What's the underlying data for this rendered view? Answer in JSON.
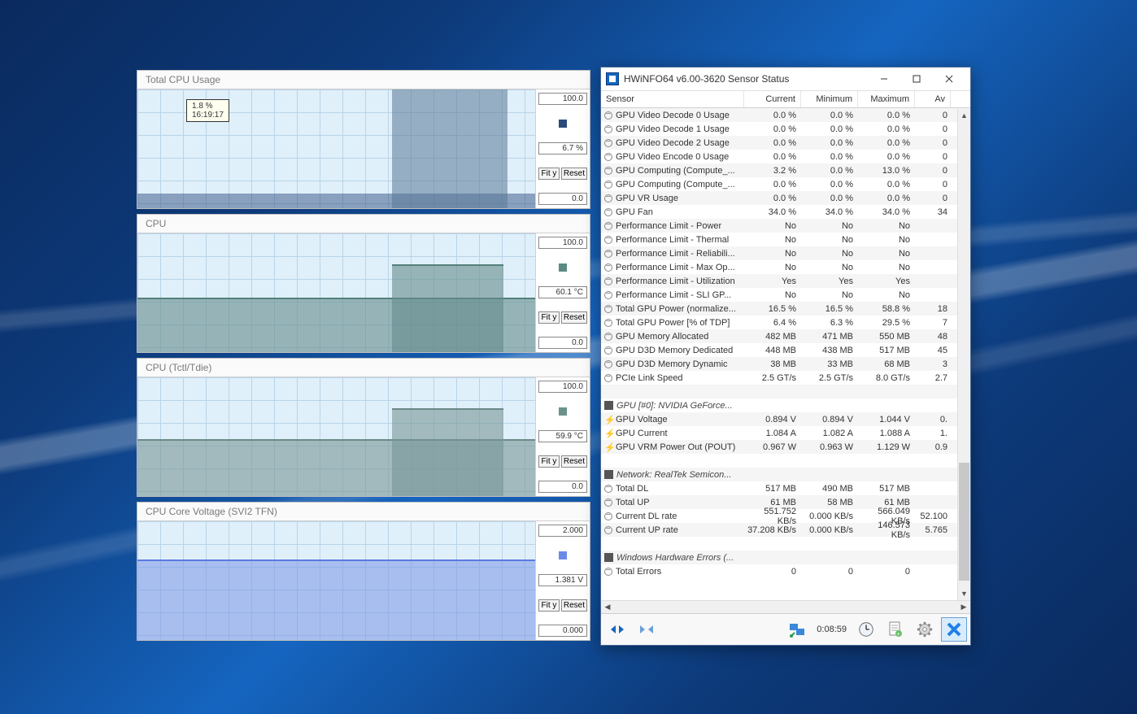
{
  "charts": [
    {
      "title": "Total CPU Usage",
      "max": "100.0",
      "current": "6.7 %",
      "min": "0.0",
      "swatch": "#2a4a7a",
      "tooltip": {
        "value": "1.8 %",
        "time": "16:19:17"
      }
    },
    {
      "title": "CPU",
      "max": "100.0",
      "current": "60.1 °C",
      "min": "0.0",
      "swatch": "#5a8a82"
    },
    {
      "title": "CPU (Tctl/Tdie)",
      "max": "100.0",
      "current": "59.9 °C",
      "min": "0.0",
      "swatch": "#6a928b"
    },
    {
      "title": "CPU Core Voltage (SVI2 TFN)",
      "max": "2.000",
      "current": "1.381 V",
      "min": "0.000",
      "swatch": "#6a8ae8"
    }
  ],
  "buttons": {
    "fity": "Fit y",
    "reset": "Reset"
  },
  "sensor_window": {
    "title": "HWiNFO64 v6.00-3620 Sensor Status",
    "columns": {
      "sensor": "Sensor",
      "current": "Current",
      "min": "Minimum",
      "max": "Maximum",
      "avg": "Av"
    },
    "timer": "0:08:59"
  },
  "rows": [
    {
      "t": "s",
      "n": "GPU Video Decode 0 Usage",
      "c": "0.0 %",
      "mi": "0.0 %",
      "ma": "0.0 %",
      "a": "0"
    },
    {
      "t": "s",
      "n": "GPU Video Decode 1 Usage",
      "c": "0.0 %",
      "mi": "0.0 %",
      "ma": "0.0 %",
      "a": "0"
    },
    {
      "t": "s",
      "n": "GPU Video Decode 2 Usage",
      "c": "0.0 %",
      "mi": "0.0 %",
      "ma": "0.0 %",
      "a": "0"
    },
    {
      "t": "s",
      "n": "GPU Video Encode 0 Usage",
      "c": "0.0 %",
      "mi": "0.0 %",
      "ma": "0.0 %",
      "a": "0"
    },
    {
      "t": "s",
      "n": "GPU Computing (Compute_...",
      "c": "3.2 %",
      "mi": "0.0 %",
      "ma": "13.0 %",
      "a": "0"
    },
    {
      "t": "s",
      "n": "GPU Computing (Compute_...",
      "c": "0.0 %",
      "mi": "0.0 %",
      "ma": "0.0 %",
      "a": "0"
    },
    {
      "t": "s",
      "n": "GPU VR Usage",
      "c": "0.0 %",
      "mi": "0.0 %",
      "ma": "0.0 %",
      "a": "0"
    },
    {
      "t": "s",
      "n": "GPU Fan",
      "c": "34.0 %",
      "mi": "34.0 %",
      "ma": "34.0 %",
      "a": "34"
    },
    {
      "t": "s",
      "n": "Performance Limit - Power",
      "c": "No",
      "mi": "No",
      "ma": "No",
      "a": ""
    },
    {
      "t": "s",
      "n": "Performance Limit - Thermal",
      "c": "No",
      "mi": "No",
      "ma": "No",
      "a": ""
    },
    {
      "t": "s",
      "n": "Performance Limit - Reliabili...",
      "c": "No",
      "mi": "No",
      "ma": "No",
      "a": ""
    },
    {
      "t": "s",
      "n": "Performance Limit - Max Op...",
      "c": "No",
      "mi": "No",
      "ma": "No",
      "a": ""
    },
    {
      "t": "s",
      "n": "Performance Limit - Utilization",
      "c": "Yes",
      "mi": "Yes",
      "ma": "Yes",
      "a": ""
    },
    {
      "t": "s",
      "n": "Performance Limit - SLI GP...",
      "c": "No",
      "mi": "No",
      "ma": "No",
      "a": ""
    },
    {
      "t": "s",
      "n": "Total GPU Power (normalize...",
      "c": "16.5 %",
      "mi": "16.5 %",
      "ma": "58.8 %",
      "a": "18"
    },
    {
      "t": "s",
      "n": "Total GPU Power [% of TDP]",
      "c": "6.4 %",
      "mi": "6.3 %",
      "ma": "29.5 %",
      "a": "7"
    },
    {
      "t": "s",
      "n": "GPU Memory Allocated",
      "c": "482 MB",
      "mi": "471 MB",
      "ma": "550 MB",
      "a": "48"
    },
    {
      "t": "s",
      "n": "GPU D3D Memory Dedicated",
      "c": "448 MB",
      "mi": "438 MB",
      "ma": "517 MB",
      "a": "45"
    },
    {
      "t": "s",
      "n": "GPU D3D Memory Dynamic",
      "c": "38 MB",
      "mi": "33 MB",
      "ma": "68 MB",
      "a": "3"
    },
    {
      "t": "s",
      "n": "PCIe Link Speed",
      "c": "2.5 GT/s",
      "mi": "2.5 GT/s",
      "ma": "8.0 GT/s",
      "a": "2.7"
    },
    {
      "t": "blank"
    },
    {
      "t": "g",
      "n": "GPU [#0]: NVIDIA GeForce..."
    },
    {
      "t": "b",
      "n": "GPU Voltage",
      "c": "0.894 V",
      "mi": "0.894 V",
      "ma": "1.044 V",
      "a": "0."
    },
    {
      "t": "b",
      "n": "GPU Current",
      "c": "1.084 A",
      "mi": "1.082 A",
      "ma": "1.088 A",
      "a": "1."
    },
    {
      "t": "b",
      "n": "GPU VRM Power Out (POUT)",
      "c": "0.967 W",
      "mi": "0.963 W",
      "ma": "1.129 W",
      "a": "0.9"
    },
    {
      "t": "blank"
    },
    {
      "t": "g",
      "n": "Network: RealTek Semicon..."
    },
    {
      "t": "s",
      "n": "Total DL",
      "c": "517 MB",
      "mi": "490 MB",
      "ma": "517 MB",
      "a": ""
    },
    {
      "t": "s",
      "n": "Total UP",
      "c": "61 MB",
      "mi": "58 MB",
      "ma": "61 MB",
      "a": ""
    },
    {
      "t": "s",
      "n": "Current DL rate",
      "c": "551.752 KB/s",
      "mi": "0.000 KB/s",
      "ma": "566.049 KB/s",
      "a": "52.100"
    },
    {
      "t": "s",
      "n": "Current UP rate",
      "c": "37.208 KB/s",
      "mi": "0.000 KB/s",
      "ma": "146.573 KB/s",
      "a": "5.765"
    },
    {
      "t": "blank"
    },
    {
      "t": "g",
      "n": "Windows Hardware Errors (..."
    },
    {
      "t": "s",
      "n": "Total Errors",
      "c": "0",
      "mi": "0",
      "ma": "0",
      "a": ""
    }
  ],
  "chart_data": [
    {
      "type": "line",
      "title": "Total CPU Usage",
      "ylim": [
        0,
        100
      ],
      "ylabel": "%",
      "series": [
        {
          "name": "Total CPU Usage",
          "color": "#2a4a7a",
          "approx_profile": [
            {
              "x_pct": 0,
              "y": 5
            },
            {
              "x_pct": 20,
              "y": 8
            },
            {
              "x_pct": 40,
              "y": 6
            },
            {
              "x_pct": 64,
              "y": 100
            },
            {
              "x_pct": 92,
              "y": 100
            },
            {
              "x_pct": 94,
              "y": 7
            },
            {
              "x_pct": 100,
              "y": 7
            }
          ]
        }
      ],
      "tooltip": {
        "value": 1.8,
        "time": "16:19:17"
      },
      "current": 6.7
    },
    {
      "type": "line",
      "title": "CPU",
      "ylim": [
        0,
        100
      ],
      "ylabel": "°C",
      "series": [
        {
          "name": "CPU",
          "color": "#5a8a82",
          "approx_profile": [
            {
              "x_pct": 0,
              "y": 46
            },
            {
              "x_pct": 64,
              "y": 46
            },
            {
              "x_pct": 66,
              "y": 74
            },
            {
              "x_pct": 92,
              "y": 72
            },
            {
              "x_pct": 100,
              "y": 60
            }
          ]
        }
      ],
      "current": 60.1
    },
    {
      "type": "line",
      "title": "CPU (Tctl/Tdie)",
      "ylim": [
        0,
        100
      ],
      "ylabel": "°C",
      "series": [
        {
          "name": "CPU (Tctl/Tdie)",
          "color": "#6a928b",
          "approx_profile": [
            {
              "x_pct": 0,
              "y": 48
            },
            {
              "x_pct": 64,
              "y": 48
            },
            {
              "x_pct": 66,
              "y": 74
            },
            {
              "x_pct": 92,
              "y": 72
            },
            {
              "x_pct": 100,
              "y": 60
            }
          ]
        }
      ],
      "current": 59.9
    },
    {
      "type": "line",
      "title": "CPU Core Voltage (SVI2 TFN)",
      "ylim": [
        0,
        2
      ],
      "ylabel": "V",
      "series": [
        {
          "name": "CPU Core Voltage",
          "color": "#6a8ae8",
          "approx_profile": [
            {
              "x_pct": 0,
              "y": 1.4
            },
            {
              "x_pct": 64,
              "y": 1.4
            },
            {
              "x_pct": 66,
              "y": 1.33
            },
            {
              "x_pct": 100,
              "y": 1.38
            }
          ]
        }
      ],
      "current": 1.381
    }
  ]
}
